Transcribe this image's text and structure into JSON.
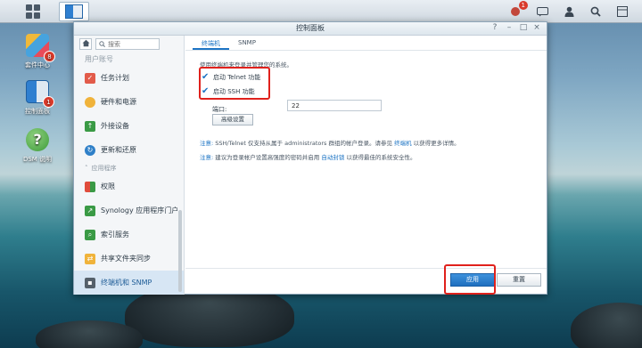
{
  "window": {
    "title": "控制面板"
  },
  "taskbar": {
    "notification_count": "1"
  },
  "desktop_icons": [
    {
      "label": "套件中心",
      "badge": "8"
    },
    {
      "label": "控制面板",
      "badge": "1"
    },
    {
      "label": "DSM 说明",
      "badge": ""
    }
  ],
  "sidebar": {
    "search_placeholder": "搜索",
    "cut_item": "用户账号",
    "items": [
      {
        "label": "任务计划",
        "color": "#e25b4a"
      },
      {
        "label": "硬件和电源",
        "color": "#f0b33b"
      },
      {
        "label": "外接设备",
        "color": "#3a9a45"
      },
      {
        "label": "更新和还原",
        "color": "#2f80c8"
      }
    ],
    "section": "应用程序",
    "items2": [
      {
        "label": "权限",
        "color": "#e04c3c"
      },
      {
        "label": "Synology 应用程序门户",
        "color": "#3a9a45"
      },
      {
        "label": "索引服务",
        "color": "#3a9a45"
      },
      {
        "label": "共享文件夹同步",
        "color": "#f0b33b"
      },
      {
        "label": "终端机和 SNMP",
        "color": "#55606a"
      }
    ]
  },
  "tabs": [
    "终端机",
    "SNMP"
  ],
  "content": {
    "description": "使用终端机来登录并管理您的系统。",
    "telnet_label": "启动 Telnet 功能",
    "ssh_label": "启动 SSH 功能",
    "port_label": "端口:",
    "port_value": "22",
    "advanced_button": "高级设置",
    "note_tag": "注意:",
    "note1_a": "SSH/Telnet 仅支持从属于 administrators 群组的帐户登录。请参见",
    "note1_link": "终端机",
    "note1_b": "以获得更多详情。",
    "note2_a": "建议为登录帐户设置高强度的密码并启用",
    "note2_link": "自动封锁",
    "note2_b": "以获得最佳的系统安全性。"
  },
  "buttons": {
    "apply": "应用",
    "reset": "重置"
  }
}
